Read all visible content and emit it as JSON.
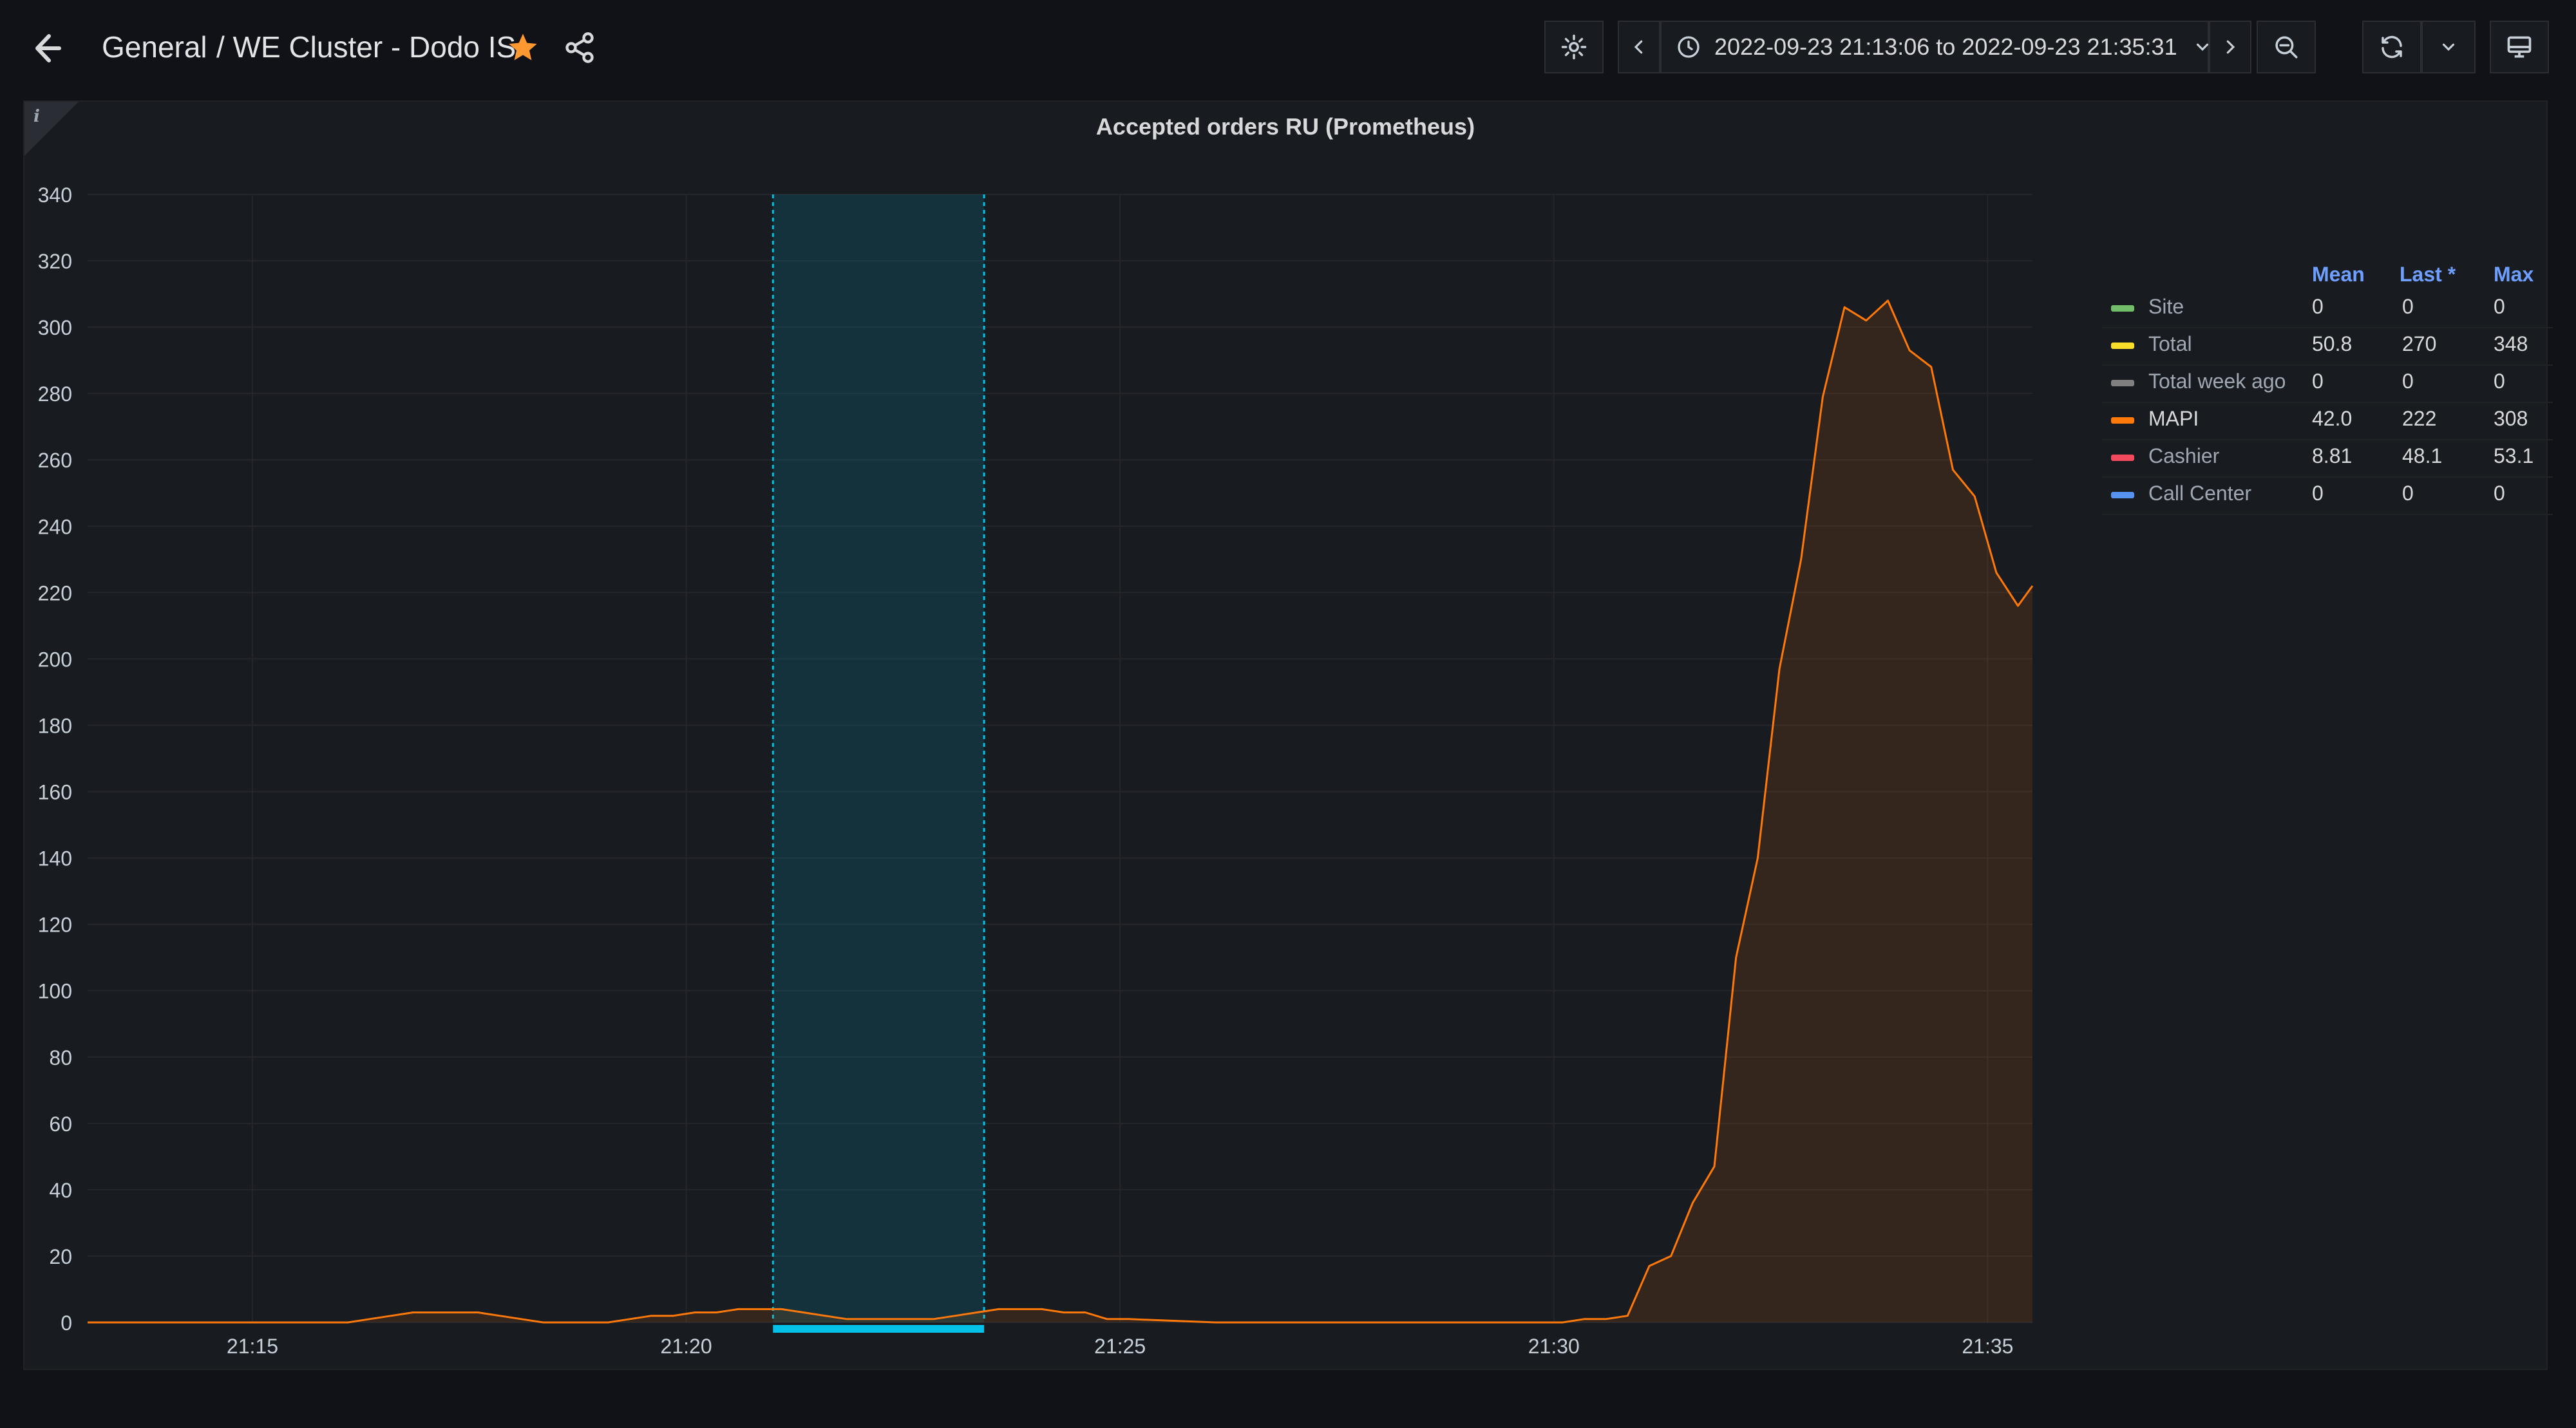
{
  "header": {
    "folder": "General",
    "dashboard_title": "/ WE Cluster - Dodo IS",
    "starred": true,
    "time_range": "2022-09-23 21:13:06 to 2022-09-23 21:35:31"
  },
  "icons": [
    "arrow-left-icon",
    "star-icon",
    "share-icon",
    "gear-icon",
    "chevron-left-icon",
    "clock-icon",
    "chevron-down-icon",
    "chevron-right-icon",
    "zoom-out-icon",
    "refresh-icon",
    "monitor-icon",
    "info-icon"
  ],
  "colors": {
    "background": "#111217",
    "panel": "#181b1f",
    "accent_blue": "#6e9fff",
    "star": "#ff9830",
    "selection": "#00c2e8",
    "site": "#73bf69",
    "total": "#fade2a",
    "total_week_ago": "#808080",
    "mapi": "#ff780a",
    "cashier": "#f2495c",
    "call_center": "#5794f2"
  },
  "panel": {
    "title": "Accepted orders RU (Prometheus)",
    "info_marker": "i"
  },
  "legend": {
    "headers": [
      "Mean",
      "Last *",
      "Max"
    ],
    "rows": [
      {
        "name": "Site",
        "color": "#73bf69",
        "mean": "0",
        "last": "0",
        "max": "0"
      },
      {
        "name": "Total",
        "color": "#fade2a",
        "mean": "50.8",
        "last": "270",
        "max": "348"
      },
      {
        "name": "Total week ago",
        "color": "#808080",
        "mean": "0",
        "last": "0",
        "max": "0"
      },
      {
        "name": "MAPI",
        "color": "#ff780a",
        "mean": "42.0",
        "last": "222",
        "max": "308"
      },
      {
        "name": "Cashier",
        "color": "#f2495c",
        "mean": "8.81",
        "last": "48.1",
        "max": "53.1"
      },
      {
        "name": "Call Center",
        "color": "#5794f2",
        "mean": "0",
        "last": "0",
        "max": "0"
      }
    ]
  },
  "chart_data": {
    "type": "area",
    "title": "Accepted orders RU (Prometheus)",
    "xlabel": "",
    "ylabel": "",
    "x_ticks": [
      "21:15",
      "21:20",
      "21:25",
      "21:30",
      "21:35"
    ],
    "y_ticks": [
      0,
      20,
      40,
      60,
      80,
      100,
      120,
      140,
      160,
      180,
      200,
      220,
      240,
      260,
      280,
      300,
      320,
      340
    ],
    "xlim": [
      "21:13:06",
      "21:35:31"
    ],
    "ylim": [
      0,
      340
    ],
    "grid": true,
    "legend_position": "right",
    "selected_range": [
      "21:21:00",
      "21:23:26"
    ],
    "series": [
      {
        "name": "MAPI",
        "color": "#ff780a",
        "x": [
          "21:13:06",
          "21:16:06",
          "21:16:21",
          "21:16:36",
          "21:16:51",
          "21:17:06",
          "21:17:36",
          "21:17:51",
          "21:18:06",
          "21:18:21",
          "21:18:36",
          "21:19:06",
          "21:19:21",
          "21:19:36",
          "21:19:51",
          "21:20:06",
          "21:20:21",
          "21:20:36",
          "21:20:51",
          "21:21:06",
          "21:21:21",
          "21:21:36",
          "21:21:51",
          "21:22:06",
          "21:22:21",
          "21:22:36",
          "21:22:51",
          "21:23:06",
          "21:23:21",
          "21:23:36",
          "21:23:51",
          "21:24:06",
          "21:24:21",
          "21:24:36",
          "21:24:51",
          "21:25:06",
          "21:26:06",
          "21:29:51",
          "21:30:06",
          "21:30:21",
          "21:30:36",
          "21:30:51",
          "21:31:06",
          "21:31:21",
          "21:31:36",
          "21:31:51",
          "21:32:06",
          "21:32:21",
          "21:32:36",
          "21:32:51",
          "21:33:06",
          "21:33:21",
          "21:33:36",
          "21:33:51",
          "21:34:06",
          "21:34:21",
          "21:34:36",
          "21:34:51",
          "21:35:06",
          "21:35:21",
          "21:35:31"
        ],
        "values": [
          0,
          0,
          1,
          2,
          3,
          3,
          3,
          2,
          1,
          0,
          0,
          0,
          1,
          2,
          2,
          3,
          3,
          4,
          4,
          4,
          3,
          2,
          1,
          1,
          1,
          1,
          1,
          2,
          3,
          4,
          4,
          4,
          3,
          3,
          1,
          1,
          0,
          0,
          0,
          1,
          1,
          2,
          17,
          20,
          36,
          47,
          110,
          140,
          197,
          230,
          279,
          306,
          302,
          308,
          293,
          288,
          257,
          249,
          226,
          216,
          222
        ]
      }
    ]
  }
}
